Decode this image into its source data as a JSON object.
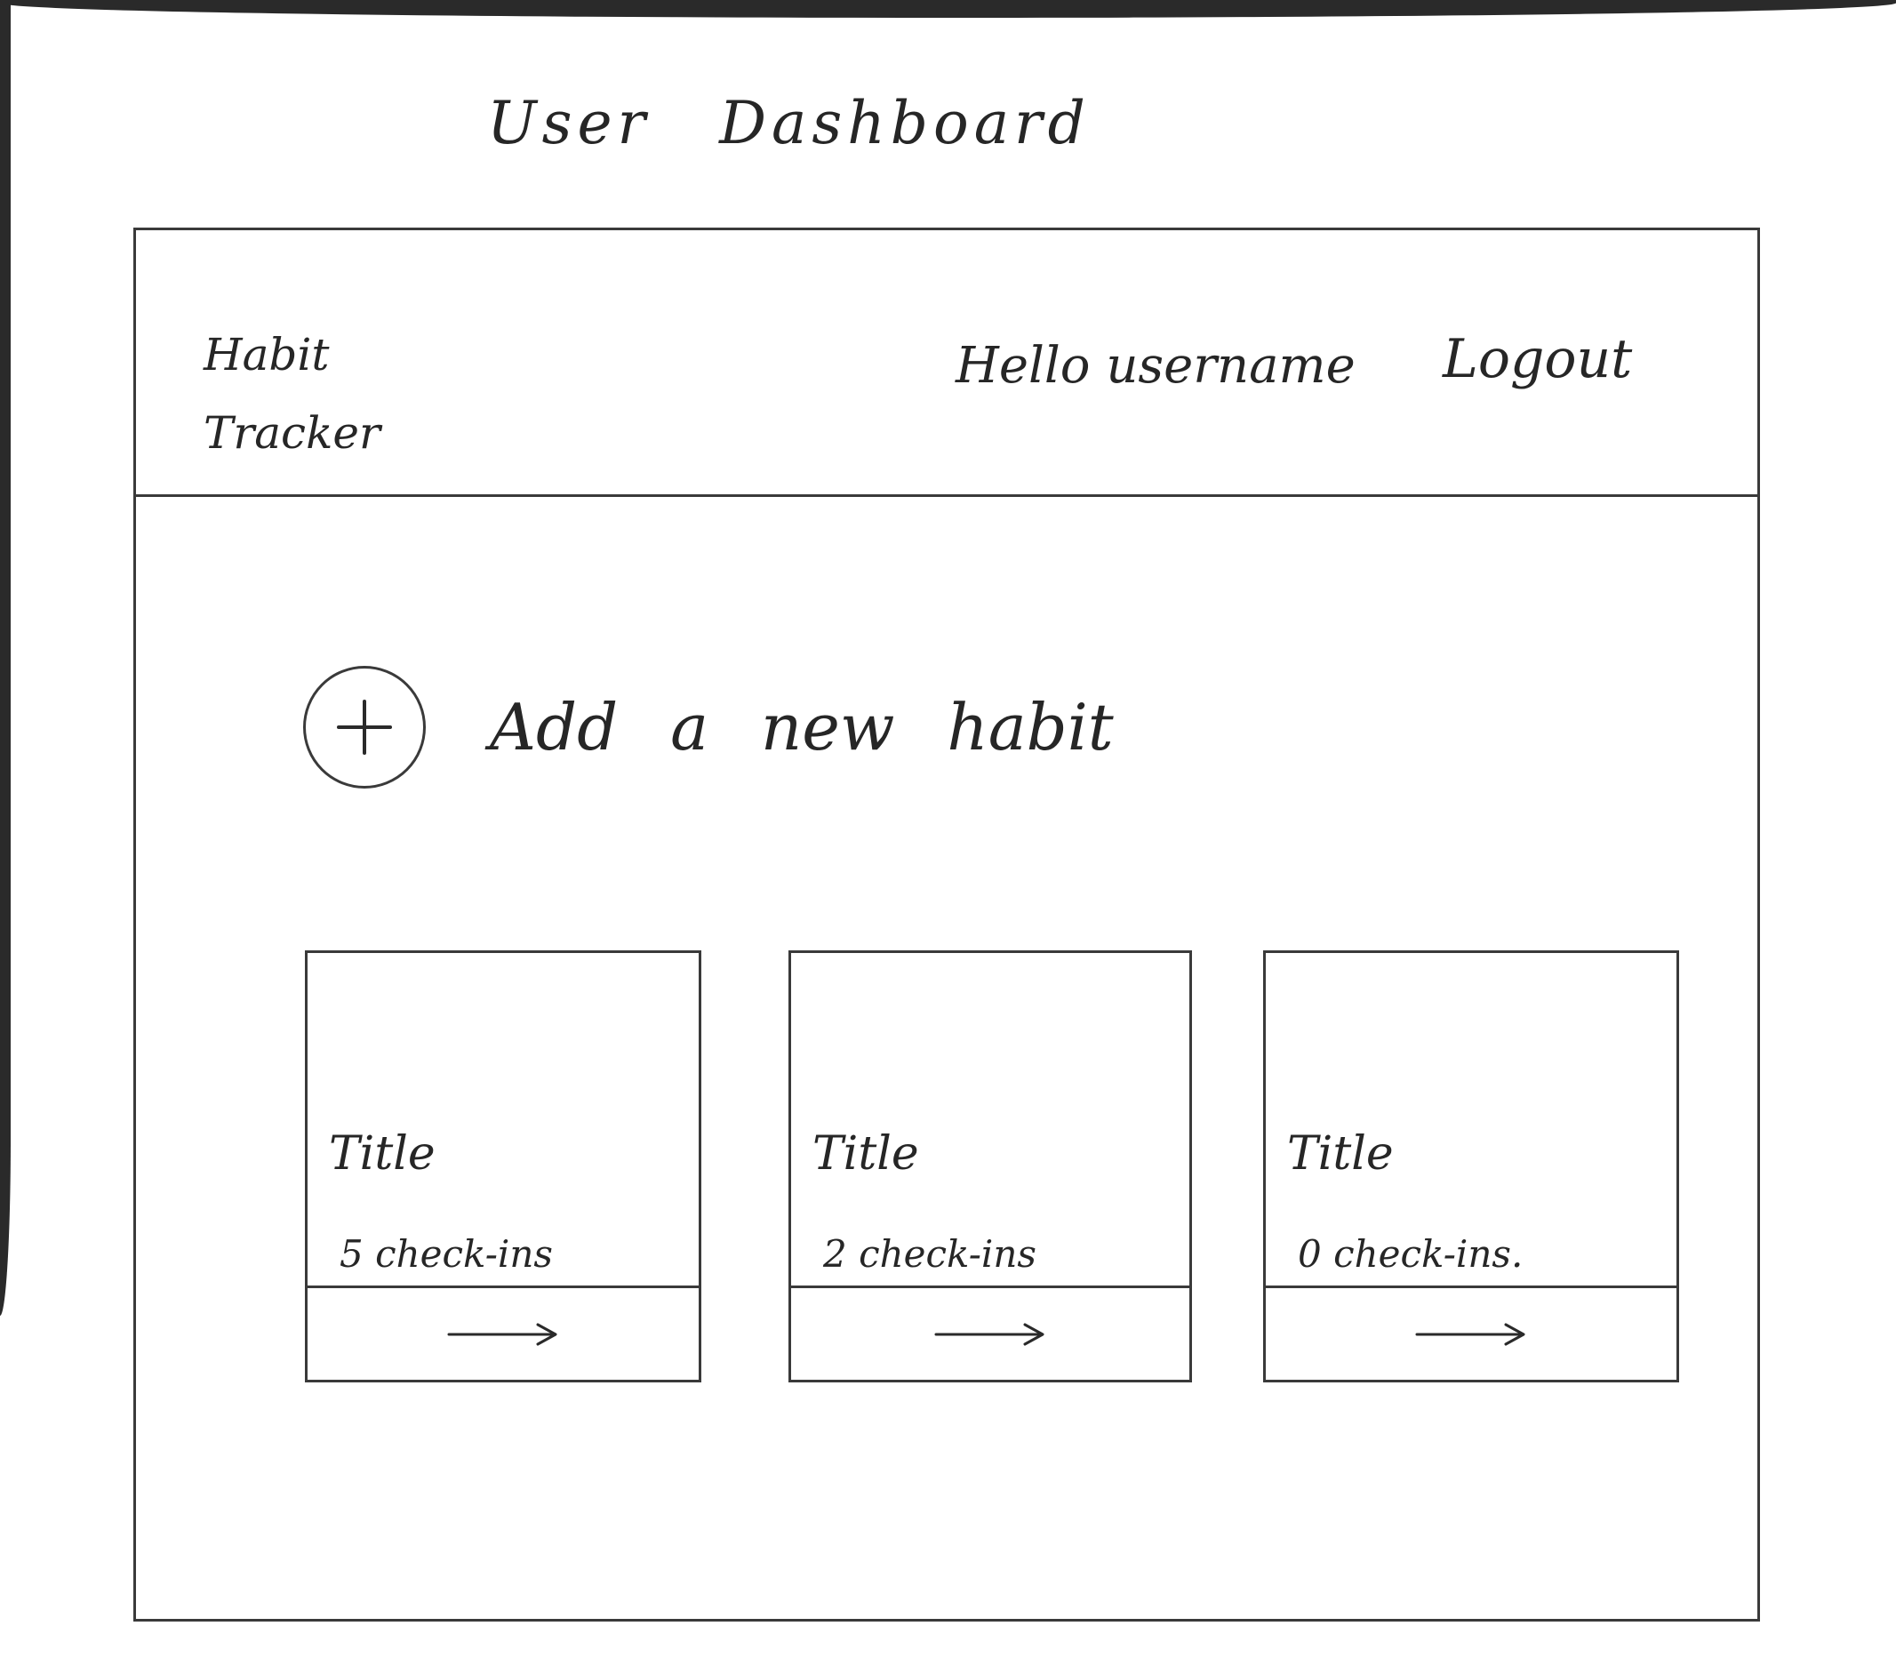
{
  "page": {
    "title": "User Dashboard"
  },
  "navbar": {
    "brand": "Habit Tracker",
    "greeting": "Hello username",
    "logout_label": "Logout"
  },
  "add_habit": {
    "icon": "plus-icon",
    "label": "Add a new habit"
  },
  "habits": [
    {
      "title": "Title",
      "checkins": "5 check-ins",
      "action_icon": "arrow-right-icon"
    },
    {
      "title": "Title",
      "checkins": "2 check-ins",
      "action_icon": "arrow-right-icon"
    },
    {
      "title": "Title",
      "checkins": "0 check-ins.",
      "action_icon": "arrow-right-icon"
    }
  ],
  "colors": {
    "ink": "#262626",
    "paper": "#ffffff"
  }
}
